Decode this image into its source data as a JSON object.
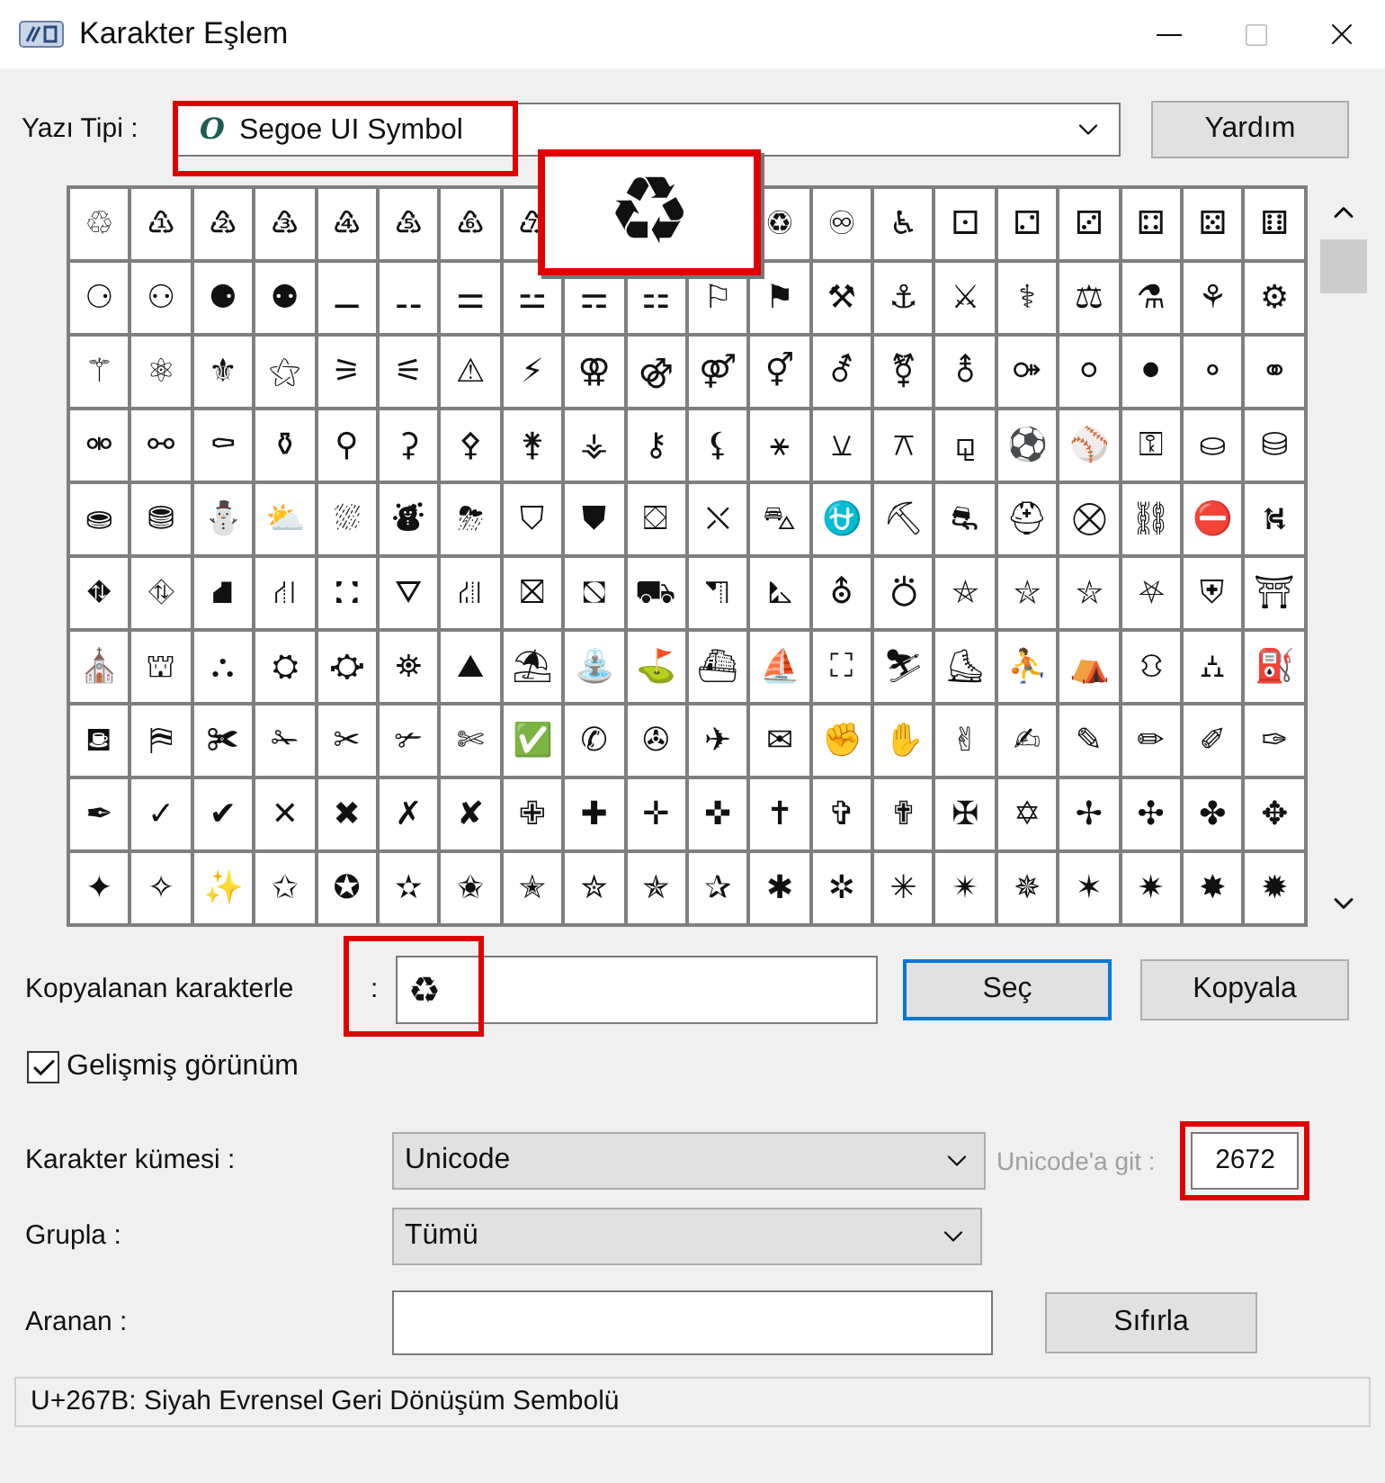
{
  "window": {
    "title": "Karakter Eşlem"
  },
  "font": {
    "label": "Yazı Tipi :",
    "value": "Segoe UI Symbol",
    "icon_glyph": "O",
    "highlighted": true
  },
  "help_button": "Yardım",
  "grid": {
    "rows": [
      [
        "♲",
        "♳",
        "♴",
        "♵",
        "♶",
        "♷",
        "♸",
        "♹",
        null,
        null,
        null,
        "♽",
        "♾",
        "♿",
        "⚀",
        "⚁",
        "⚂",
        "⚃",
        "⚄",
        "⚅"
      ],
      [
        "⚆",
        "⚇",
        "⚈",
        "⚉",
        "⚊",
        "⚋",
        "⚌",
        "⚍",
        "⚎",
        "⚏",
        "⚐",
        "⚑",
        "⚒",
        "⚓",
        "⚔",
        "⚕",
        "⚖",
        "⚗",
        "⚘",
        "⚙"
      ],
      [
        "⚚",
        "⚛",
        "⚜",
        "⚝",
        "⚞",
        "⚟",
        "⚠",
        "⚡",
        "⚢",
        "⚣",
        "⚤",
        "⚥",
        "⚦",
        "⚧",
        "⚨",
        "⚩",
        "⚪",
        "⚫",
        "⚬",
        "⚭"
      ],
      [
        "⚮",
        "⚯",
        "⚰",
        "⚱",
        "⚲",
        "⚳",
        "⚴",
        "⚵",
        "⚶",
        "⚷",
        "⚸",
        "⚹",
        "⚺",
        "⚻",
        "⚼",
        "⚽",
        "⚾",
        "⚿",
        "⛀",
        "⛁"
      ],
      [
        "⛂",
        "⛃",
        "⛄",
        "⛅",
        "⛆",
        "⛇",
        "⛈",
        "⛉",
        "⛊",
        "⛋",
        "⛌",
        "⛍",
        "⛎",
        "⛏",
        "⛐",
        "⛑",
        "⛒",
        "⛓",
        "⛔",
        "⛕"
      ],
      [
        "⛖",
        "⛗",
        "⛘",
        "⛙",
        "⛚",
        "⛛",
        "⛜",
        "⛝",
        "⛞",
        "⛟",
        "⛠",
        "⛡",
        "⛢",
        "⛣",
        "⛤",
        "⛥",
        "⛦",
        "⛧",
        "⛨",
        "⛩"
      ],
      [
        "⛪",
        "⛫",
        "⛬",
        "⛭",
        "⛮",
        "⛯",
        "⛰",
        "⛱",
        "⛲",
        "⛳",
        "⛴",
        "⛵",
        "⛶",
        "⛷",
        "⛸",
        "⛹",
        "⛺",
        "⛻",
        "⛼",
        "⛽"
      ],
      [
        "⛾",
        "⛿",
        "✀",
        "✁",
        "✂",
        "✃",
        "✄",
        "✅",
        "✆",
        "✇",
        "✈",
        "✉",
        "✊",
        "✋",
        "✌",
        "✍",
        "✎",
        "✏",
        "✐",
        "✑"
      ],
      [
        "✒",
        "✓",
        "✔",
        "✕",
        "✖",
        "✗",
        "✘",
        "✙",
        "✚",
        "✛",
        "✜",
        "✝",
        "✞",
        "✟",
        "✠",
        "✡",
        "✢",
        "✣",
        "✤",
        "✥"
      ],
      [
        "✦",
        "✧",
        "✨",
        "✩",
        "✪",
        "✫",
        "✬",
        "✭",
        "✮",
        "✯",
        "✰",
        "✱",
        "✲",
        "✳",
        "✴",
        "✵",
        "✶",
        "✷",
        "✸",
        "✹"
      ]
    ],
    "popup": {
      "glyph": "♻",
      "highlighted": true
    }
  },
  "copy": {
    "label": "Kopyalanan karakterle",
    "colon": ":",
    "value": "♻",
    "highlighted": true,
    "select_button": "Seç",
    "copy_button": "Kopyala"
  },
  "advanced": {
    "label": "Gelişmiş görünüm",
    "checked": true
  },
  "charset": {
    "label": "Karakter kümesi :",
    "value": "Unicode"
  },
  "goto": {
    "label": "Unicode'a git :",
    "disabled": true,
    "value": "2672",
    "highlighted": true
  },
  "group": {
    "label": "Grupla :",
    "value": "Tümü"
  },
  "search": {
    "label": "Aranan :",
    "reset_button": "Sıfırla"
  },
  "status_bar": "U+267B: Siyah Evrensel Geri Dönüşüm Sembolü"
}
